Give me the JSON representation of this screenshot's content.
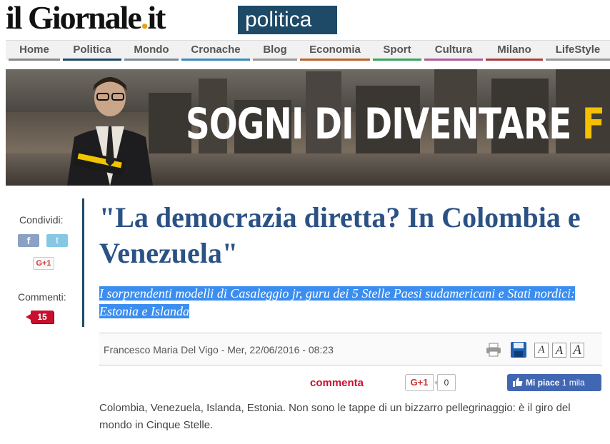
{
  "header": {
    "logo_main": "il Giornale",
    "logo_dot": ".",
    "logo_tld": "it",
    "section": "politica"
  },
  "nav": {
    "items": [
      {
        "label": "Home",
        "color": "#888888"
      },
      {
        "label": "Politica",
        "color": "#1e4a68"
      },
      {
        "label": "Mondo",
        "color": "#7a8a9a"
      },
      {
        "label": "Cronache",
        "color": "#3a8ac0"
      },
      {
        "label": "Blog",
        "color": "#999999"
      },
      {
        "label": "Economia",
        "color": "#c0602a"
      },
      {
        "label": "Sport",
        "color": "#3aa35a"
      },
      {
        "label": "Cultura",
        "color": "#b05a9a"
      },
      {
        "label": "Milano",
        "color": "#b03a3a"
      },
      {
        "label": "LifeStyle",
        "color": "#999999"
      }
    ]
  },
  "banner": {
    "text": "SOGNI DI DIVENTARE ",
    "text_tail": "F"
  },
  "share": {
    "label": "Condividi:",
    "facebook": "f",
    "twitter": "t",
    "gplus": "G+1",
    "comments_label": "Commenti:",
    "comments_count": "15"
  },
  "article": {
    "headline": "\"La democrazia diretta? In Colombia e Venezuela\"",
    "subtitle": "I sorprendenti modelli di Casaleggio jr, guru dei 5 Stelle Paesi sudamericani e Stati nordici: Estonia e Islanda",
    "meta": "Francesco Maria Del Vigo - Mer, 22/06/2016 - 08:23",
    "font_buttons": [
      "A",
      "A",
      "A"
    ],
    "commenta": "commenta",
    "gplus_label": "G+1",
    "gplus_count": "0",
    "fb_like": "Mi piace",
    "fb_like_count": "1 mila",
    "body": "Colombia, Venezuela, Islanda, Estonia. Non sono le tappe di un bizzarro pellegrinaggio: è il giro del mondo in Cinque Stelle."
  },
  "colors": {
    "brand": "#1e4a68",
    "headline": "#2b5285",
    "accent_red": "#c8102e",
    "selection": "#3b8ef0"
  }
}
